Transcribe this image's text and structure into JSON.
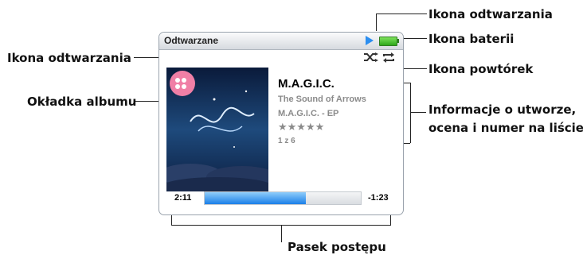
{
  "device": {
    "title": "Odtwarzane",
    "track": {
      "title": "M.A.G.I.C.",
      "artist": "The Sound of Arrows",
      "album": "M.A.G.I.C. - EP",
      "rating_stars": "★★★★★",
      "position": "1 z 6"
    },
    "elapsed": "2:11",
    "remaining": "-1:23",
    "progress": 0.65,
    "icons": [
      "play-icon",
      "battery-icon",
      "shuffle-icon",
      "repeat-icon"
    ]
  },
  "callouts": {
    "playback_icon_top": "Ikona odtwarzania",
    "battery_icon": "Ikona baterii",
    "playback_icon_left": "Ikona odtwarzania",
    "repeat_icon": "Ikona powtórek",
    "album_cover": "Okładka albumu",
    "track_info_line1": "Informacje o utworze,",
    "track_info_line2": "ocena i numer na liście",
    "progress_bar": "Pasek postępu"
  },
  "colors": {
    "progress": "#1a7fe8",
    "battery": "#2ea71a",
    "play_icon": "#2b8ef0"
  }
}
